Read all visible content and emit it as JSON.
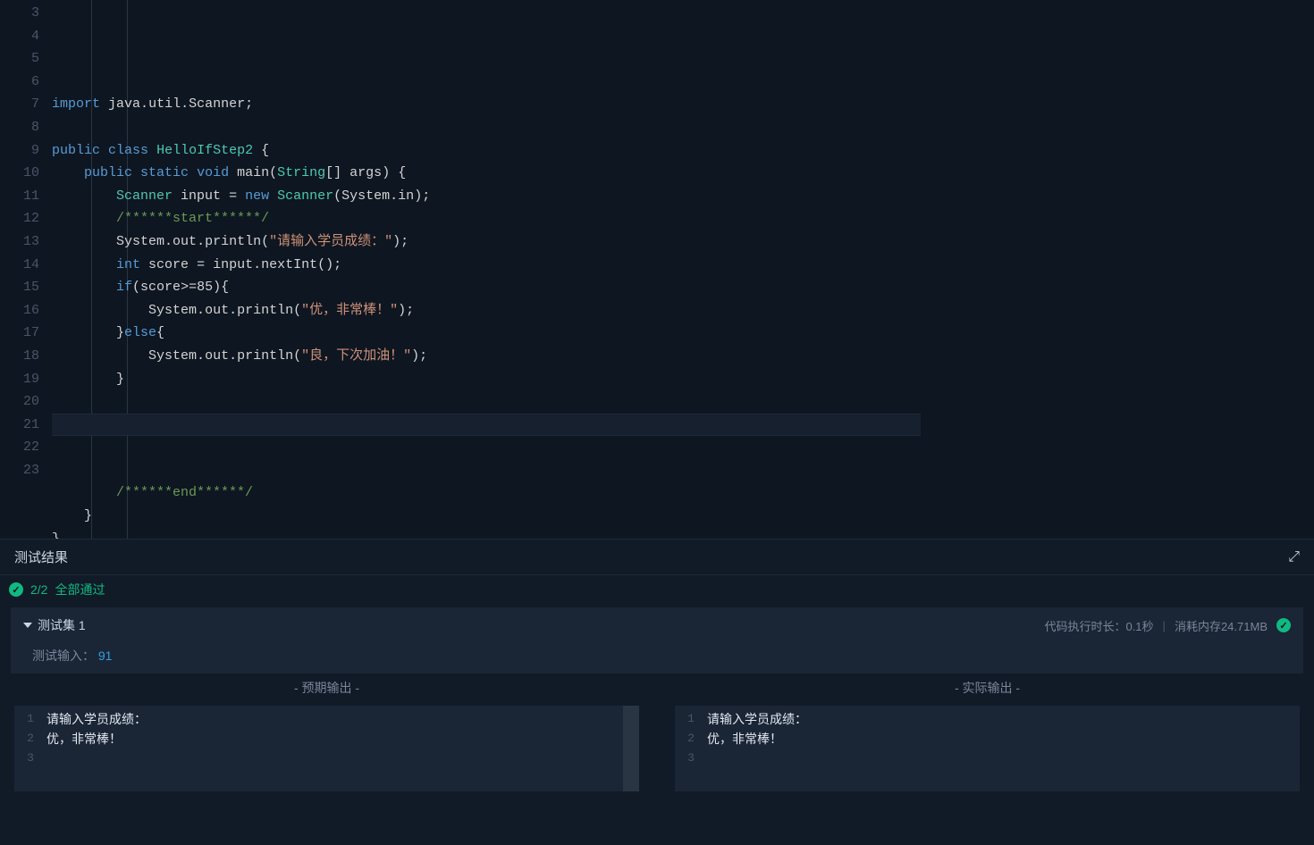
{
  "editor": {
    "first_line_no": 3,
    "lines": [
      {
        "n": 3,
        "indent": 0,
        "segs": [
          {
            "c": "kw",
            "t": "import"
          },
          {
            "c": "pun",
            "t": " "
          },
          {
            "c": "ident",
            "t": "java"
          },
          {
            "c": "pun",
            "t": "."
          },
          {
            "c": "ident",
            "t": "util"
          },
          {
            "c": "pun",
            "t": "."
          },
          {
            "c": "ident",
            "t": "Scanner"
          },
          {
            "c": "pun",
            "t": ";"
          }
        ]
      },
      {
        "n": 4,
        "indent": 0,
        "segs": []
      },
      {
        "n": 5,
        "indent": 0,
        "segs": [
          {
            "c": "kw",
            "t": "public"
          },
          {
            "c": "pun",
            "t": " "
          },
          {
            "c": "kw",
            "t": "class"
          },
          {
            "c": "pun",
            "t": " "
          },
          {
            "c": "type",
            "t": "HelloIfStep2"
          },
          {
            "c": "pun",
            "t": " {"
          }
        ]
      },
      {
        "n": 6,
        "indent": 1,
        "segs": [
          {
            "c": "kw",
            "t": "public"
          },
          {
            "c": "pun",
            "t": " "
          },
          {
            "c": "kw",
            "t": "static"
          },
          {
            "c": "pun",
            "t": " "
          },
          {
            "c": "kw",
            "t": "void"
          },
          {
            "c": "pun",
            "t": " "
          },
          {
            "c": "fn",
            "t": "main"
          },
          {
            "c": "pun",
            "t": "("
          },
          {
            "c": "type",
            "t": "String"
          },
          {
            "c": "pun",
            "t": "[] "
          },
          {
            "c": "ident",
            "t": "args"
          },
          {
            "c": "pun",
            "t": ") {"
          }
        ]
      },
      {
        "n": 7,
        "indent": 2,
        "segs": [
          {
            "c": "type",
            "t": "Scanner"
          },
          {
            "c": "pun",
            "t": " "
          },
          {
            "c": "ident",
            "t": "input"
          },
          {
            "c": "pun",
            "t": " = "
          },
          {
            "c": "kw",
            "t": "new"
          },
          {
            "c": "pun",
            "t": " "
          },
          {
            "c": "type",
            "t": "Scanner"
          },
          {
            "c": "pun",
            "t": "("
          },
          {
            "c": "ident",
            "t": "System"
          },
          {
            "c": "pun",
            "t": "."
          },
          {
            "c": "ident",
            "t": "in"
          },
          {
            "c": "pun",
            "t": ");"
          }
        ]
      },
      {
        "n": 8,
        "indent": 2,
        "segs": [
          {
            "c": "cmt",
            "t": "/******start******/"
          }
        ]
      },
      {
        "n": 9,
        "indent": 2,
        "segs": [
          {
            "c": "ident",
            "t": "System"
          },
          {
            "c": "pun",
            "t": "."
          },
          {
            "c": "ident",
            "t": "out"
          },
          {
            "c": "pun",
            "t": "."
          },
          {
            "c": "fn",
            "t": "println"
          },
          {
            "c": "pun",
            "t": "("
          },
          {
            "c": "str",
            "t": "\"请输入学员成绩：\""
          },
          {
            "c": "pun",
            "t": ");"
          }
        ]
      },
      {
        "n": 10,
        "indent": 2,
        "segs": [
          {
            "c": "kw",
            "t": "int"
          },
          {
            "c": "pun",
            "t": " "
          },
          {
            "c": "ident",
            "t": "score"
          },
          {
            "c": "pun",
            "t": " = "
          },
          {
            "c": "ident",
            "t": "input"
          },
          {
            "c": "pun",
            "t": "."
          },
          {
            "c": "fn",
            "t": "nextInt"
          },
          {
            "c": "pun",
            "t": "();"
          }
        ]
      },
      {
        "n": 11,
        "indent": 2,
        "segs": [
          {
            "c": "kw",
            "t": "if"
          },
          {
            "c": "pun",
            "t": "("
          },
          {
            "c": "ident",
            "t": "score"
          },
          {
            "c": "pun",
            "t": ">="
          },
          {
            "c": "ident",
            "t": "85"
          },
          {
            "c": "pun",
            "t": "){"
          }
        ]
      },
      {
        "n": 12,
        "indent": 3,
        "segs": [
          {
            "c": "ident",
            "t": "System"
          },
          {
            "c": "pun",
            "t": "."
          },
          {
            "c": "ident",
            "t": "out"
          },
          {
            "c": "pun",
            "t": "."
          },
          {
            "c": "fn",
            "t": "println"
          },
          {
            "c": "pun",
            "t": "("
          },
          {
            "c": "str",
            "t": "\"优，非常棒！\""
          },
          {
            "c": "pun",
            "t": ");"
          }
        ]
      },
      {
        "n": 13,
        "indent": 2,
        "segs": [
          {
            "c": "pun",
            "t": "}"
          },
          {
            "c": "kw",
            "t": "else"
          },
          {
            "c": "pun",
            "t": "{"
          }
        ]
      },
      {
        "n": 14,
        "indent": 3,
        "segs": [
          {
            "c": "ident",
            "t": "System"
          },
          {
            "c": "pun",
            "t": "."
          },
          {
            "c": "ident",
            "t": "out"
          },
          {
            "c": "pun",
            "t": "."
          },
          {
            "c": "fn",
            "t": "println"
          },
          {
            "c": "pun",
            "t": "("
          },
          {
            "c": "str",
            "t": "\"良，下次加油！\""
          },
          {
            "c": "pun",
            "t": ");"
          }
        ]
      },
      {
        "n": 15,
        "indent": 2,
        "segs": [
          {
            "c": "pun",
            "t": "}"
          }
        ]
      },
      {
        "n": 16,
        "indent": 0,
        "segs": []
      },
      {
        "n": 17,
        "indent": 0,
        "segs": [],
        "cursor": true
      },
      {
        "n": 18,
        "indent": 0,
        "segs": []
      },
      {
        "n": 19,
        "indent": 0,
        "segs": []
      },
      {
        "n": 20,
        "indent": 2,
        "segs": [
          {
            "c": "cmt",
            "t": "/******end******/"
          }
        ]
      },
      {
        "n": 21,
        "indent": 1,
        "segs": [
          {
            "c": "pun",
            "t": "}"
          }
        ]
      },
      {
        "n": 22,
        "indent": 0,
        "segs": [
          {
            "c": "pun",
            "t": "}"
          }
        ]
      },
      {
        "n": 23,
        "indent": 0,
        "segs": []
      }
    ]
  },
  "results": {
    "panel_title": "测试结果",
    "status_count": "2/2",
    "status_text": "全部通过",
    "testset": {
      "title": "测试集 1",
      "exec_time_label": "代码执行时长：",
      "exec_time_value": "0.1秒",
      "memory_label": "消耗内存",
      "memory_value": "24.71MB",
      "input_label": "测试输入：",
      "input_value": "91"
    },
    "expected_label": "- 预期输出 -",
    "actual_label": "- 实际输出 -",
    "expected_lines": [
      "请输入学员成绩：",
      "优，非常棒！",
      ""
    ],
    "actual_lines": [
      "请输入学员成绩：",
      "优，非常棒！",
      ""
    ]
  }
}
